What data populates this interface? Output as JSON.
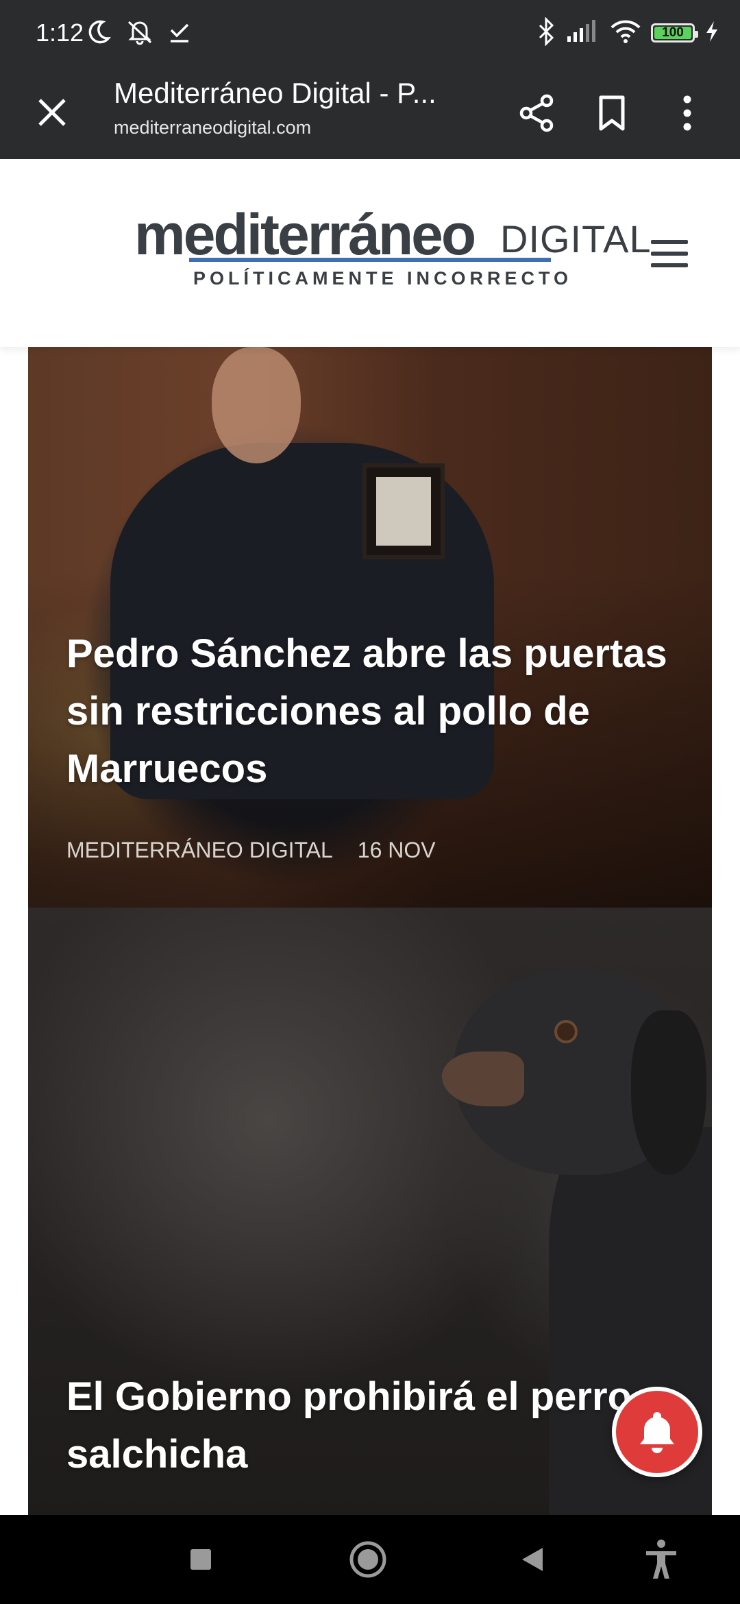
{
  "status_bar": {
    "time": "1:12",
    "battery": "100",
    "icons_left": [
      "moon-icon",
      "notifications-off-icon",
      "check-download-icon"
    ],
    "icons_right": [
      "bluetooth-icon",
      "signal-icon",
      "wifi-icon",
      "battery-icon",
      "charging-icon"
    ]
  },
  "toolbar": {
    "title": "Mediterráneo Digital - P...",
    "url": "mediterraneodigital.com",
    "icons": [
      "close-icon",
      "share-icon",
      "bookmark-icon",
      "more-vert-icon"
    ]
  },
  "site": {
    "logo_word": "mediterráneo",
    "logo_digital": "DIGITAL",
    "tagline": "POLÍTICAMENTE INCORRECTO",
    "colors": {
      "logo_text": "#3a3f45",
      "logo_accent": "#3f6fb2"
    }
  },
  "articles": [
    {
      "title": "Pedro Sánchez abre las puertas sin restricciones al pollo de Marruecos",
      "source": "MEDITERRÁNEO DIGITAL",
      "date": "16 NOV"
    },
    {
      "title": "El Gobierno prohibirá el perro salchicha"
    }
  ],
  "notification_button": {
    "icon": "bell-icon",
    "color": "#e03b3b"
  },
  "nav_bar": {
    "icons": [
      "recents-icon",
      "home-icon",
      "back-icon",
      "accessibility-icon"
    ]
  }
}
